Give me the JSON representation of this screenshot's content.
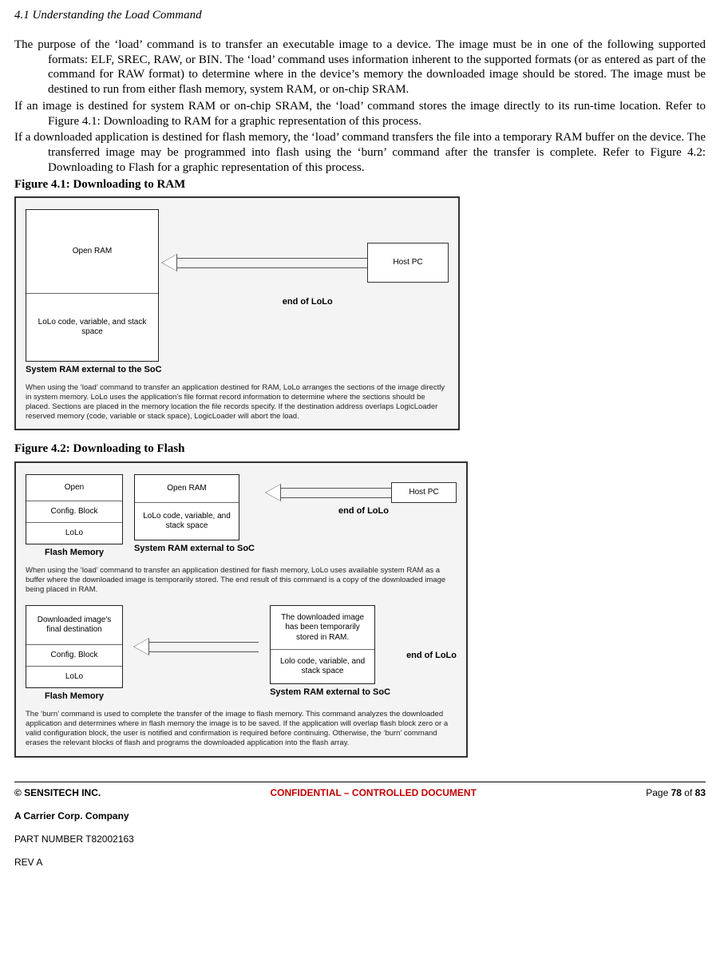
{
  "section": {
    "title": "4.1 Understanding the Load Command"
  },
  "body": {
    "p1": "The purpose of the ‘load’ command is to transfer an executable image to a device. The image must be in one of the following supported formats: ELF, SREC, RAW, or BIN. The ‘load’ command uses information inherent to the supported formats (or as entered as part of the command for RAW format) to determine where in the device’s memory the downloaded image should be stored. The image must be destined to run from either flash memory, system RAM, or on-chip SRAM.",
    "p2": "If an image is destined for system RAM or on-chip SRAM, the ‘load’ command stores the image directly to its run-time location. Refer to Figure 4.1: Downloading to RAM for a graphic representation of this process.",
    "p3": "If a downloaded application is destined for flash memory, the ‘load’ command transfers the file into a temporary RAM buffer on the device. The transferred image may be programmed into flash using the ‘burn’ command after the transfer is complete. Refer to Figure 4.2: Downloading to Flash for a graphic representation of this process."
  },
  "fig1": {
    "caption": "Figure 4.1: Downloading to RAM",
    "ram": {
      "open": "Open RAM",
      "lolo": "LoLo code, variable, and stack space",
      "label": "System RAM external to the SoC"
    },
    "end_label": "end of LoLo",
    "host": "Host PC",
    "desc": "When using the ‘load’ command to transfer an application destined for RAM, LoLo arranges the sections of the image directly in system memory. LoLo uses the application's file format record information to determine where the sections should be placed. Sections are placed in the memory location the file records specify. If the destination address overlaps LogicLoader reserved memory (code, variable or stack space), LogicLoader will abort the load."
  },
  "fig2": {
    "caption": "Figure 4.2: Downloading to Flash",
    "step1": {
      "flash": {
        "open": "Open",
        "cfg": "Config. Block",
        "lolo": "LoLo",
        "label": "Flash Memory"
      },
      "ram": {
        "open": "Open RAM",
        "lolo": "LoLo code, variable, and stack space",
        "label": "System RAM external to SoC"
      },
      "end_label": "end of LoLo",
      "host": "Host PC",
      "desc": "When using the ‘load’ command to transfer an application destined for flash memory, LoLo uses available system RAM as a buffer where the downloaded image is temporarily stored. The end result of this command is a copy of the downloaded image being placed in RAM."
    },
    "step2": {
      "flash": {
        "dest": "Downloaded image's final destination",
        "cfg": "Config. Block",
        "lolo": "LoLo",
        "label": "Flash Memory"
      },
      "ram": {
        "stored": "The downloaded image has been temporarily stored in RAM.",
        "lolo": "Lolo code, variable, and stack space",
        "label": "System RAM external to SoC"
      },
      "end_label": "end of LoLo",
      "desc": "The ‘burn’ command is used to complete the transfer of the image to flash memory. This command analyzes the downloaded application and determines where in flash memory the image is to be saved. If the application will overlap flash block zero or a valid configuration block, the user is notified and confirmation is required before continuing. Otherwise, the ‘burn’ command erases the relevant blocks of flash and programs the downloaded application into the flash array."
    }
  },
  "footer": {
    "left": "© SENSITECH INC.",
    "center": "CONFIDENTIAL – CONTROLLED DOCUMENT",
    "right_prefix": "Page ",
    "page_cur": "78",
    "right_mid": " of ",
    "page_total": "83",
    "company": "A Carrier Corp. Company",
    "part": "PART NUMBER T82002163",
    "rev": "REV A"
  }
}
